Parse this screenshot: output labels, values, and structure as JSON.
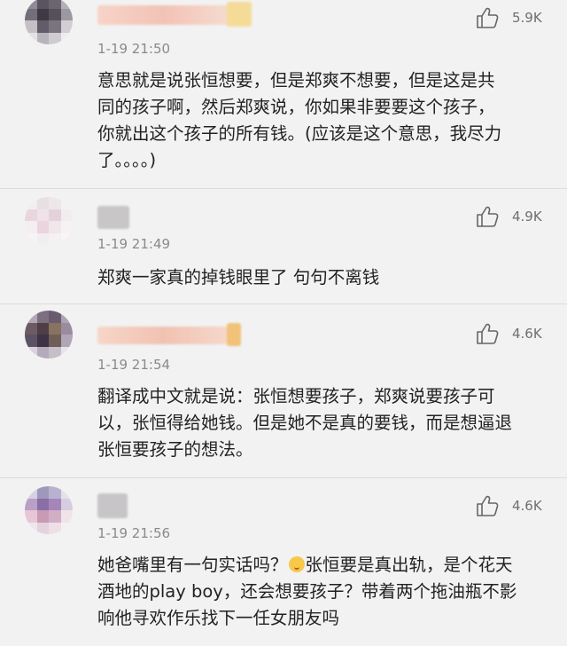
{
  "comments": [
    {
      "time": "1-19 21:50",
      "likes": "5.9K",
      "lines": [
        "意思就是说张恒想要，但是郑爽不想要，但是这是共",
        "同的孩子啊，然后郑爽说，你如果非要要这个孩子，",
        "你就出这个孩子的所有钱。(应该是这个意思，我尽力",
        "了。。。。)"
      ]
    },
    {
      "time": "1-19 21:49",
      "likes": "4.9K",
      "lines": [
        "郑爽一家真的掉钱眼里了  句句不离钱"
      ]
    },
    {
      "time": "1-19 21:54",
      "likes": "4.6K",
      "lines": [
        "翻译成中文就是说：张恒想要孩子，郑爽说要孩子可",
        "以，张恒得给她钱。但是她不是真的要钱，而是想逼退",
        "张恒要孩子的想法。"
      ]
    },
    {
      "time": "1-19 21:56",
      "likes": "4.6K",
      "line1_before": "她爸嘴里有一句实话吗？",
      "line1_after": "张恒要是真出轨，是个花天",
      "lines": [
        "酒地的play boy，还会想要孩子？带着两个拖油瓶不影",
        "响他寻欢作乐找下一任女朋友吗"
      ]
    }
  ],
  "icons": {
    "like": "thumbs-up-icon",
    "emoji": "yum-emoji-icon"
  },
  "colors": {
    "background": "#f2f2f2",
    "time": "#8a8a8a",
    "text": "#222222"
  }
}
